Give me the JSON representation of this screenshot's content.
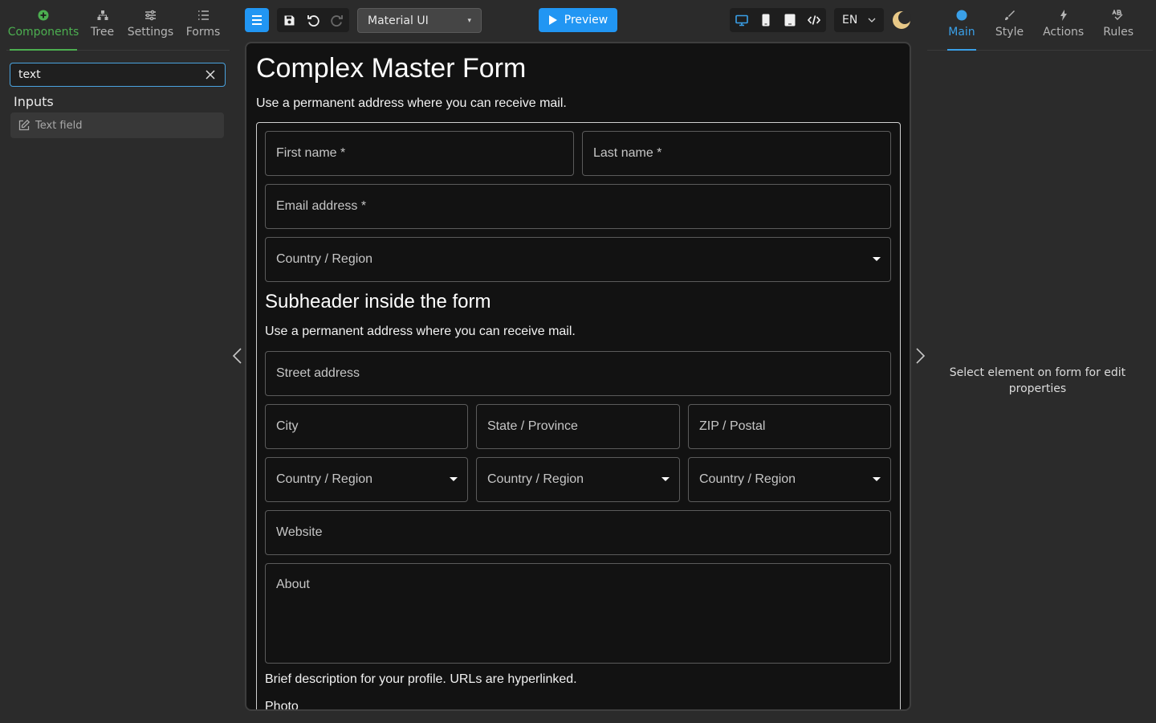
{
  "left_tabs": [
    {
      "label": "Components",
      "icon": "plus-circle-icon"
    },
    {
      "label": "Tree",
      "icon": "tree-icon"
    },
    {
      "label": "Settings",
      "icon": "sliders-icon"
    },
    {
      "label": "Forms",
      "icon": "list-icon"
    }
  ],
  "search": {
    "value": "text"
  },
  "components": {
    "group_title": "Inputs",
    "items": [
      {
        "label": "Text field",
        "icon": "edit-icon"
      }
    ]
  },
  "toolbar": {
    "theme_value": "Material UI",
    "preview_label": "Preview",
    "language": "EN"
  },
  "form": {
    "title": "Complex Master Form",
    "subtitle": "Use a permanent address where you can receive mail.",
    "first_name": "First name *",
    "last_name": "Last name *",
    "email": "Email address *",
    "country_region": "Country / Region",
    "subheader": "Subheader inside the form",
    "subheader_text": "Use a permanent address where you can receive mail.",
    "street": "Street address",
    "city": "City",
    "state": "State / Province",
    "zip": "ZIP / Postal",
    "country_1": "Country / Region",
    "country_2": "Country / Region",
    "country_3": "Country / Region",
    "website": "Website",
    "about": "About",
    "about_help": "Brief description for your profile. URLs are hyperlinked.",
    "photo": "Photo"
  },
  "right_tabs": [
    {
      "label": "Main",
      "icon": "dot-icon"
    },
    {
      "label": "Style",
      "icon": "brush-icon"
    },
    {
      "label": "Actions",
      "icon": "bolt-icon"
    },
    {
      "label": "Rules",
      "icon": "rules-icon"
    }
  ],
  "right_panel": {
    "message": "Select element on form for edit properties"
  },
  "colors": {
    "accent_green": "#4caf50",
    "accent_blue": "#2196f3",
    "canvas_bg": "#121212"
  }
}
